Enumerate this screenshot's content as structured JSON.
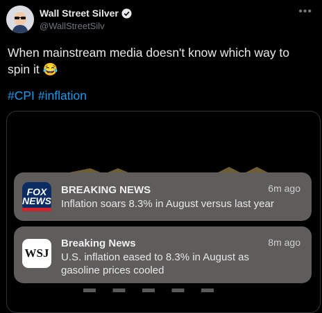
{
  "author": {
    "name": "Wall Street Silver",
    "handle": "@WallStreetSilv"
  },
  "more_icon": "ellipsis-icon",
  "tweet": {
    "text": "When mainstream media doesn't know which way to spin it 😂",
    "hashtags": [
      "#CPI",
      "#inflation"
    ]
  },
  "notifications": [
    {
      "app": "fox-news",
      "icon_text_top": "FOX",
      "icon_text_bottom": "NEWS",
      "title": "BREAKING NEWS",
      "time": "6m ago",
      "body": "Inflation soars 8.3% in August versus last year"
    },
    {
      "app": "wsj",
      "icon_text": "WSJ",
      "title": "Breaking News",
      "time": "8m ago",
      "body": " U.S. inflation eased to 8.3% in August as gasoline prices cooled"
    }
  ],
  "colors": {
    "background": "#000000",
    "hashtag": "#1d9bf0",
    "notification": "#5e5d5c",
    "fox_blue": "#0c2c64",
    "fox_red": "#d8202f"
  }
}
